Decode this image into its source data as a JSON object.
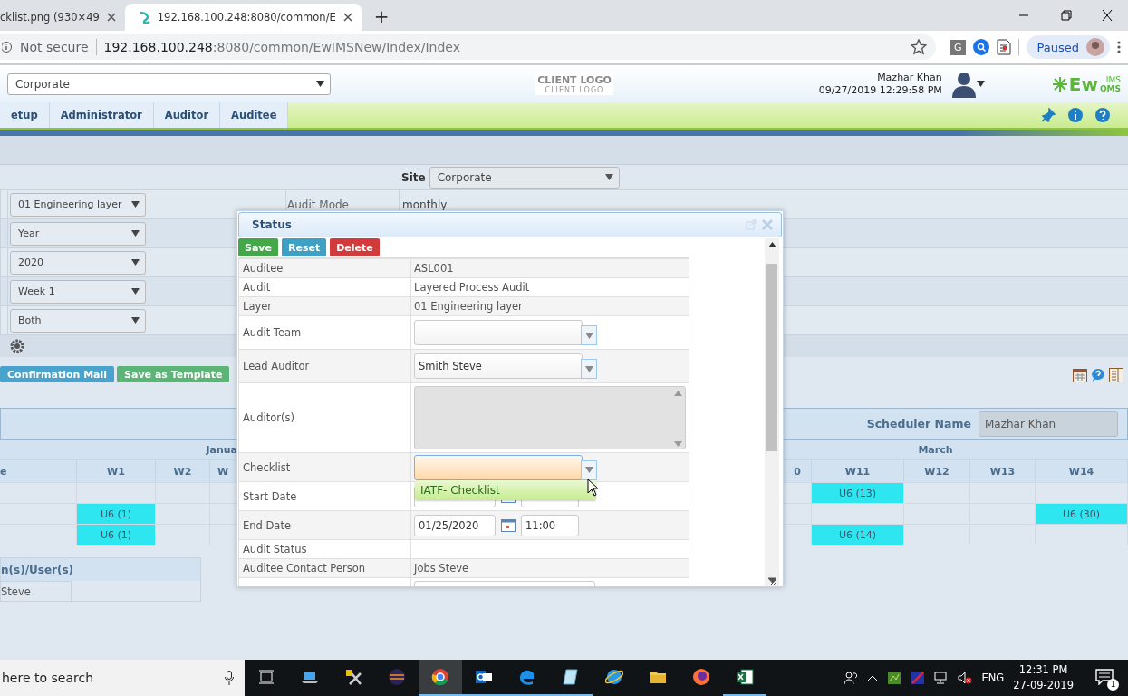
{
  "browser": {
    "tabs": [
      {
        "title": "cklist.png (930×49",
        "selected": false
      },
      {
        "title": "192.168.100.248:8080/common/E",
        "selected": true
      }
    ],
    "new_tab": "+",
    "address": {
      "security": "Not secure",
      "host": "192.168.100.248",
      "path": ":8080/common/EwIMSNew/Index/Index"
    },
    "extension": "G",
    "profile": "Paused"
  },
  "header": {
    "site_select": "Corporate",
    "client_logo": "CLIENT LOGO",
    "client_logo_sub": "CLIENT LOGO",
    "user_name": "Mazhar Khan",
    "datetime": "09/27/2019 12:29:58 PM",
    "logo": {
      "main": "Ew",
      "top": "IMS",
      "bottom": "QMS"
    }
  },
  "menu": [
    {
      "label": "etup",
      "selected": false
    },
    {
      "label": "Administrator",
      "selected": false
    },
    {
      "label": "Auditor",
      "selected": false
    },
    {
      "label": "Auditee",
      "selected": false
    }
  ],
  "filters": {
    "site_label": "Site",
    "site": "Corporate",
    "rows": [
      {
        "select": "01 Engineering layer",
        "label": "Audit Mode",
        "value": "monthly"
      },
      {
        "select": "Year"
      },
      {
        "select": "2020"
      },
      {
        "select": "Week 1"
      },
      {
        "select": "Both"
      }
    ]
  },
  "actions": [
    {
      "label": "Confirmation Mail",
      "kind": "info"
    },
    {
      "label": "Save as Template",
      "kind": "success"
    }
  ],
  "scheduler": {
    "name_label": "Scheduler Name",
    "name_value": "Mazhar Khan",
    "months": [
      "Janua",
      "March"
    ],
    "weeks": [
      "e",
      "W1",
      "W2",
      "W",
      "0",
      "W11",
      "W12",
      "W13",
      "W14"
    ],
    "rows": [
      [
        {
          "filled": false
        },
        {
          "filled": false
        },
        {
          "filled": false
        },
        {
          "filled": false
        },
        {
          "filled": false
        },
        {
          "filled": true,
          "text": "U6 (13)"
        },
        {
          "filled": false
        },
        {
          "filled": false
        },
        {
          "filled": false
        }
      ],
      [
        {
          "filled": false
        },
        {
          "filled": true,
          "text": "U6 (1)"
        },
        {
          "filled": false
        },
        {
          "filled": false
        },
        {
          "filled": false
        },
        {
          "filled": false
        },
        {
          "filled": false
        },
        {
          "filled": false
        },
        {
          "filled": true,
          "text": "U6 (30)"
        }
      ],
      [
        {
          "filled": false
        },
        {
          "filled": true,
          "text": "U6 (1)"
        },
        {
          "filled": false
        },
        {
          "filled": false
        },
        {
          "filled": false
        },
        {
          "filled": true,
          "text": "U6 (14)"
        },
        {
          "filled": false
        },
        {
          "filled": false
        },
        {
          "filled": false
        }
      ]
    ]
  },
  "users": {
    "header": "n(s)/User(s)",
    "value": "Steve"
  },
  "dialog": {
    "title": "Status",
    "buttons": [
      {
        "label": "Save",
        "kind": "save"
      },
      {
        "label": "Reset",
        "kind": "reset"
      },
      {
        "label": "Delete",
        "kind": "delete"
      }
    ],
    "fields": [
      {
        "label": "Auditee",
        "kind": "text",
        "value": "ASL001"
      },
      {
        "label": "Audit",
        "kind": "text",
        "value": "Layered Process Audit"
      },
      {
        "label": "Layer",
        "kind": "text",
        "value": "01 Engineering layer"
      },
      {
        "label": "Audit Team",
        "kind": "combo",
        "focused": false
      },
      {
        "label": "Lead Auditor",
        "kind": "combo",
        "focused": false,
        "value": "Smith Steve"
      },
      {
        "label": "Auditor(s)",
        "kind": "list"
      },
      {
        "label": "Checklist",
        "kind": "combo",
        "focused": true
      },
      {
        "label": "Start Date",
        "kind": "datetime"
      },
      {
        "label": "End Date",
        "kind": "datetime",
        "date": "01/25/2020",
        "time": "11:00"
      },
      {
        "label": "Audit Status",
        "kind": "text"
      },
      {
        "label": "Auditee Contact Person",
        "kind": "text",
        "value": "Jobs Steve"
      },
      {
        "kind": "partial"
      }
    ],
    "dropdown_option": "IATF- Checklist"
  },
  "taskbar": {
    "search": "here to search",
    "apps": [
      {
        "kind": "taskview",
        "selected": false,
        "running": false
      },
      {
        "kind": "laptop",
        "selected": false,
        "running": false
      },
      {
        "kind": "tools",
        "selected": false,
        "running": false
      },
      {
        "kind": "sphere",
        "selected": false,
        "running": false
      },
      {
        "kind": "wheel",
        "selected": true,
        "running": true
      },
      {
        "kind": "mail",
        "selected": false,
        "running": true
      },
      {
        "kind": "edge",
        "selected": false,
        "running": true
      },
      {
        "kind": "notepad",
        "selected": false,
        "running": true
      },
      {
        "kind": "globe",
        "selected": false,
        "running": false
      },
      {
        "kind": "folder",
        "selected": false,
        "running": false
      },
      {
        "kind": "fox",
        "selected": false,
        "running": false
      },
      {
        "kind": "sheet",
        "selected": false,
        "running": true
      }
    ],
    "language": "ENG",
    "time": "12:31 PM",
    "date": "27-09-2019",
    "notifications": "1"
  }
}
